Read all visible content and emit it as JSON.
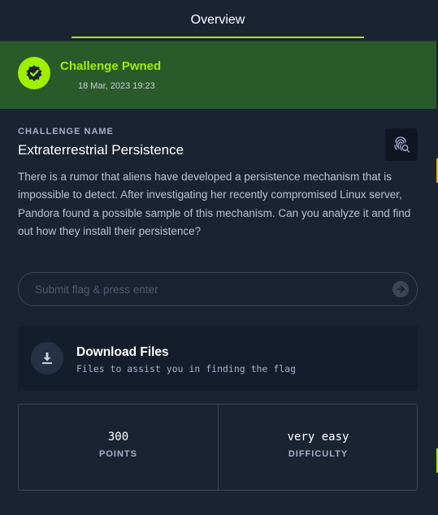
{
  "tabs": {
    "overview_label": "Overview"
  },
  "banner": {
    "status": "Challenge Pwned",
    "date": "18 Mar, 2023 19:23"
  },
  "challenge": {
    "section_label": "CHALLENGE NAME",
    "name": "Extraterrestrial Persistence",
    "description": "There is a rumor that aliens have developed a persistence mechanism that is impossible to detect. After investigating her recently compromised Linux server, Pandora found a possible sample of this mechanism. Can you analyze it and find out how they install their persistence?"
  },
  "flag_input": {
    "placeholder": "Submit flag & press enter",
    "value": ""
  },
  "download": {
    "title": "Download Files",
    "subtitle": "Files to assist you in finding the flag"
  },
  "stats": {
    "points_value": "300",
    "points_label": "POINTS",
    "difficulty_value": "very easy",
    "difficulty_label": "DIFFICULTY"
  },
  "icons": {
    "badge": "verified-check-icon",
    "fingerprint": "fingerprint-search-icon",
    "submit": "arrow-right-icon",
    "download": "download-icon"
  },
  "colors": {
    "accent": "#9fef00",
    "banner_bg": "#2a5a2a",
    "page_bg": "#1a2332",
    "card_bg": "#141d2b"
  }
}
